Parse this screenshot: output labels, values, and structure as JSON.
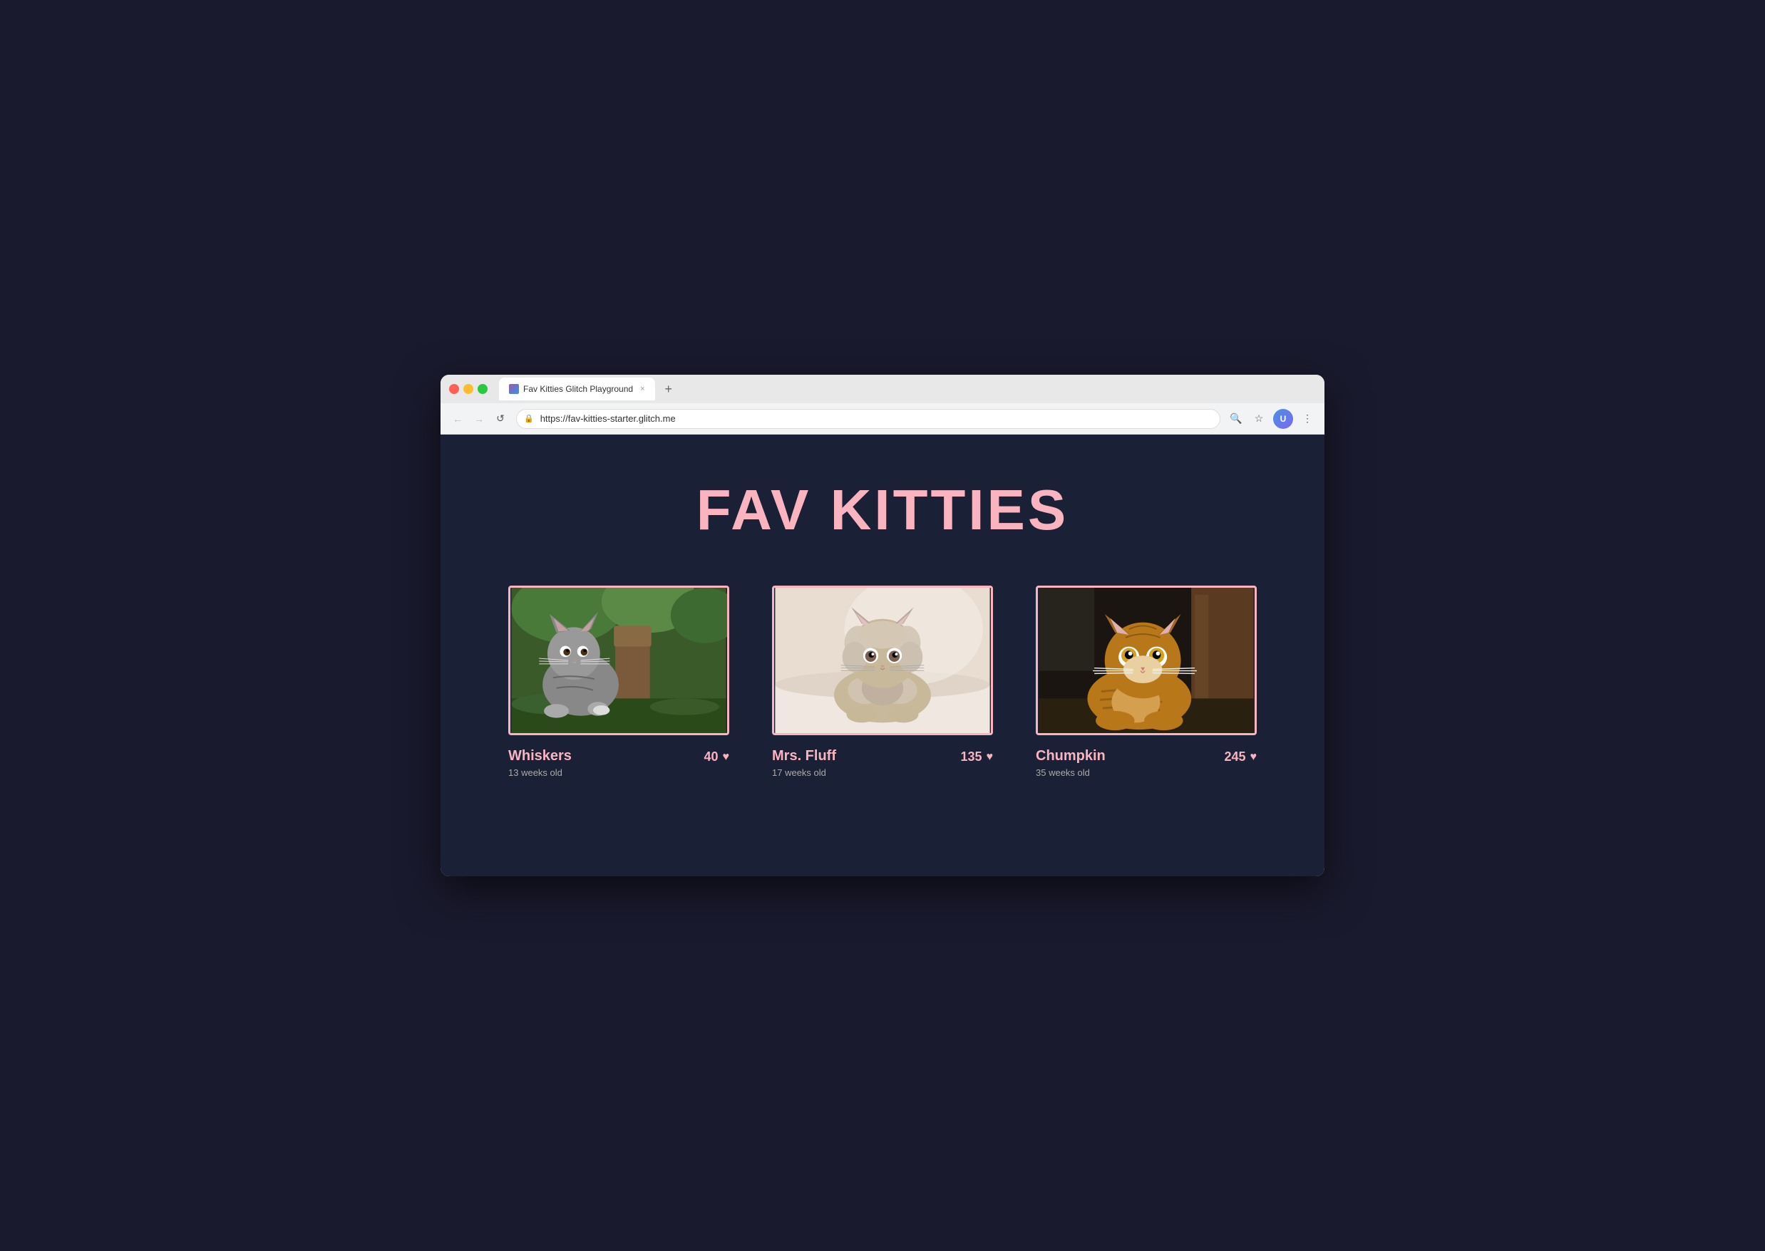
{
  "browser": {
    "tab_favicon_label": "glitch-icon",
    "tab_title": "Fav Kitties Glitch Playground",
    "tab_close_label": "×",
    "tab_new_label": "+",
    "nav_back_label": "←",
    "nav_forward_label": "→",
    "nav_reload_label": "↺",
    "address_lock_label": "🔒",
    "address_url": "https://fav-kitties-starter.glitch.me",
    "action_search_label": "🔍",
    "action_bookmark_label": "☆",
    "action_menu_label": "⋮"
  },
  "page": {
    "title": "FAV KITTIES",
    "accent_color": "#f9b4c0",
    "bg_color": "#1a2035"
  },
  "kitties": [
    {
      "id": "whiskers",
      "name": "Whiskers",
      "age": "13 weeks old",
      "likes": "40",
      "heart": "♥"
    },
    {
      "id": "mrs-fluff",
      "name": "Mrs. Fluff",
      "age": "17 weeks old",
      "likes": "135",
      "heart": "♥"
    },
    {
      "id": "chumpkin",
      "name": "Chumpkin",
      "age": "35 weeks old",
      "likes": "245",
      "heart": "♥"
    }
  ]
}
